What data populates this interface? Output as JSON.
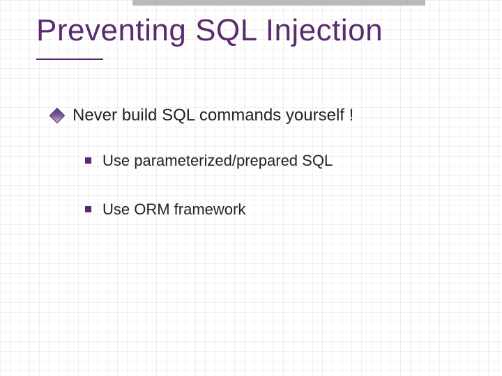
{
  "slide": {
    "title": "Preventing SQL Injection",
    "bullets": {
      "level1": {
        "b0": "Never build SQL commands yourself !"
      },
      "level2": {
        "b0": "Use  parameterized/prepared  SQL",
        "b1": "Use  ORM  framework"
      }
    }
  }
}
